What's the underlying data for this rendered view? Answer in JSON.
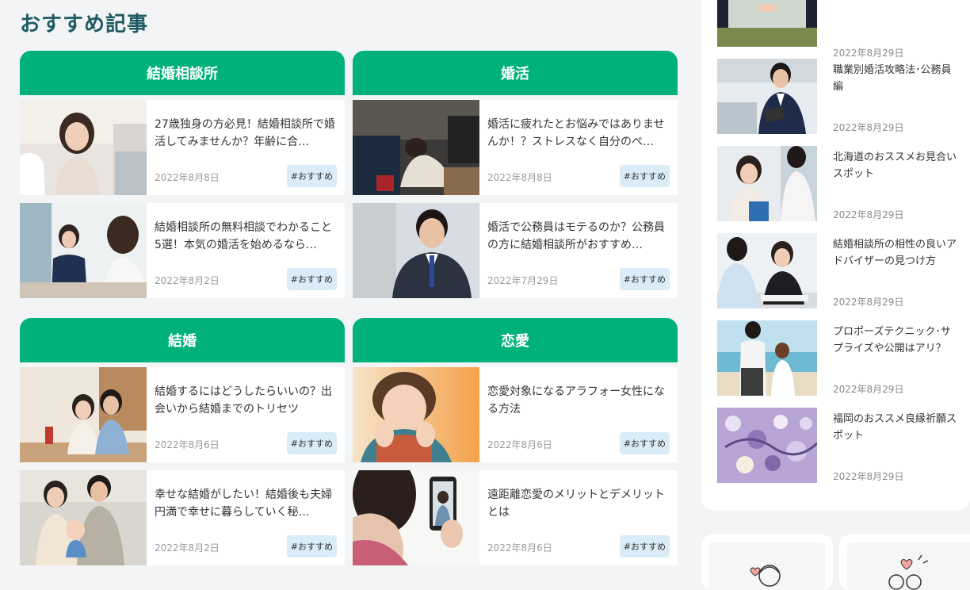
{
  "section": {
    "title": "おすすめ記事"
  },
  "categories": [
    {
      "name": "結婚相談所",
      "articles": [
        {
          "title": "27歳独身の方必見！結婚相談所で婚活してみませんか？年齢に合…",
          "date": "2022年8月8日",
          "tag": "#おすすめ"
        },
        {
          "title": "結婚相談所の無料相談でわかること5選！本気の婚活を始めるなら…",
          "date": "2022年8月2日",
          "tag": "#おすすめ"
        }
      ]
    },
    {
      "name": "婚活",
      "articles": [
        {
          "title": "婚活に疲れたとお悩みではありませんか！？ストレスなく自分のぺ…",
          "date": "2022年8月8日",
          "tag": "#おすすめ"
        },
        {
          "title": "婚活で公務員はモテるのか？公務員の方に結婚相談所がおすすめ…",
          "date": "2022年7月29日",
          "tag": "#おすすめ"
        }
      ]
    },
    {
      "name": "結婚",
      "articles": [
        {
          "title": "結婚するにはどうしたらいいの？出会いから結婚までのトリセツ",
          "date": "2022年8月6日",
          "tag": "#おすすめ"
        },
        {
          "title": "幸せな結婚がしたい！結婚後も夫婦円満で幸せに暮らしていく秘…",
          "date": "2022年8月2日",
          "tag": "#おすすめ"
        }
      ]
    },
    {
      "name": "恋愛",
      "articles": [
        {
          "title": "恋愛対象になるアラフォー女性になる方法",
          "date": "2022年8月6日",
          "tag": "#おすすめ"
        },
        {
          "title": "遠距離恋愛のメリットとデメリットとは",
          "date": "2022年8月6日",
          "tag": "#おすすめ"
        }
      ]
    }
  ],
  "sidebar": {
    "items": [
      {
        "title": "",
        "date": "2022年8月29日"
      },
      {
        "title": "職業別婚活攻略法･公務員編",
        "date": "2022年8月29日"
      },
      {
        "title": "北海道のおススメお見合いスポット",
        "date": "2022年8月29日"
      },
      {
        "title": "結婚相談所の相性の良いアドバイザーの見つけ方",
        "date": "2022年8月29日"
      },
      {
        "title": "プロポーズテクニック･サプライズや公開はアリ？",
        "date": "2022年8月29日"
      },
      {
        "title": "福岡のおススメ良縁祈願スポット",
        "date": "2022年8月29日"
      }
    ]
  },
  "colors": {
    "accent": "#00b27a",
    "title": "#1f5b63",
    "tag_bg": "#d9ecf7"
  }
}
